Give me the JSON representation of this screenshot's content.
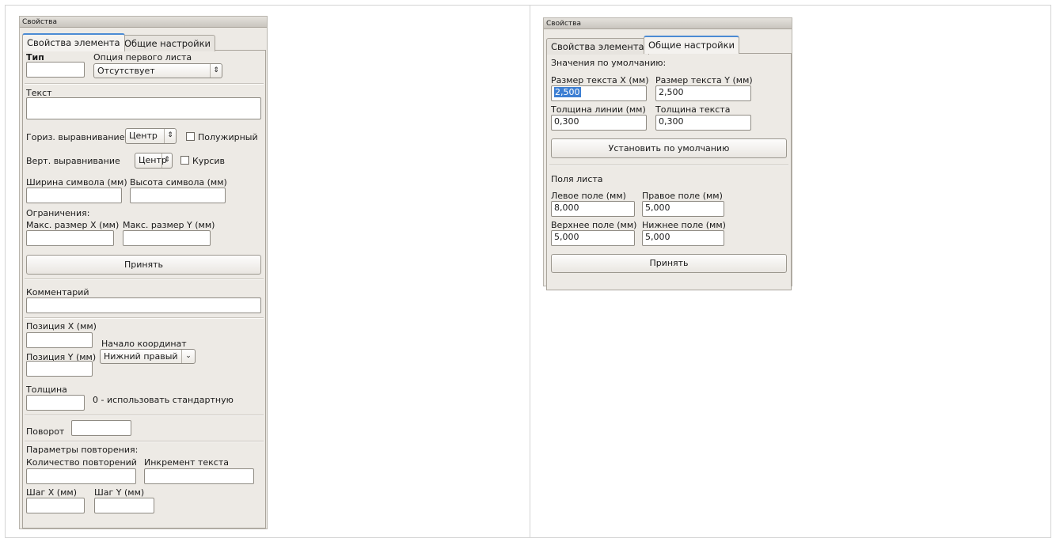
{
  "left": {
    "panel_title": "Свойства",
    "tabs": [
      "Свойства элемента",
      "Общие настройки"
    ],
    "type_label": "Тип",
    "first_sheet_label": "Опция первого листа",
    "first_sheet_value": "Отсутствует",
    "text_label": "Текст",
    "h_align_label": "Гориз. выравнивание",
    "h_align_value": "Центр",
    "bold_label": "Полужирный",
    "v_align_label": "Верт. выравнивание",
    "v_align_value": "Центр",
    "italic_label": "Курсив",
    "char_width_label": "Ширина символа (мм)",
    "char_height_label": "Высота символа (мм)",
    "limits_label": "Ограничения:",
    "max_x_label": "Макс. размер X (мм)",
    "max_y_label": "Макс. размер Y (мм)",
    "apply_label": "Принять",
    "comment_label": "Комментарий",
    "pos_x_label": "Позиция X (мм)",
    "origin_label": "Начало координат",
    "pos_y_label": "Позиция Y (мм)",
    "origin_value": "Нижний правый",
    "thickness_label": "Толщина",
    "thickness_hint": "0 - использовать стандартную",
    "rotation_label": "Поворот",
    "repeat_label": "Параметры повторения:",
    "repeat_count_label": "Количество повторений",
    "text_increment_label": "Инкремент текста",
    "step_x_label": "Шаг X (мм)",
    "step_y_label": "Шаг Y (мм)"
  },
  "right": {
    "panel_title": "Свойства",
    "tabs": [
      "Свойства элемента",
      "Общие настройки"
    ],
    "defaults_label": "Значения по умолчанию:",
    "text_size_x_label": "Размер текста X (мм)",
    "text_size_x_value": "2,500",
    "text_size_y_label": "Размер текста Y (мм)",
    "text_size_y_value": "2,500",
    "line_width_label": "Толщина линии (мм)",
    "line_width_value": "0,300",
    "text_thickness_label": "Толщина текста",
    "text_thickness_value": "0,300",
    "set_default_label": "Установить по умолчанию",
    "margins_label": "Поля листа",
    "left_margin_label": "Левое поле (мм)",
    "left_margin_value": "8,000",
    "right_margin_label": "Правое поле (мм)",
    "right_margin_value": "5,000",
    "top_margin_label": "Верхнее поле (мм)",
    "top_margin_value": "5,000",
    "bottom_margin_label": "Нижнее поле (мм)",
    "bottom_margin_value": "5,000",
    "apply_label": "Принять"
  }
}
